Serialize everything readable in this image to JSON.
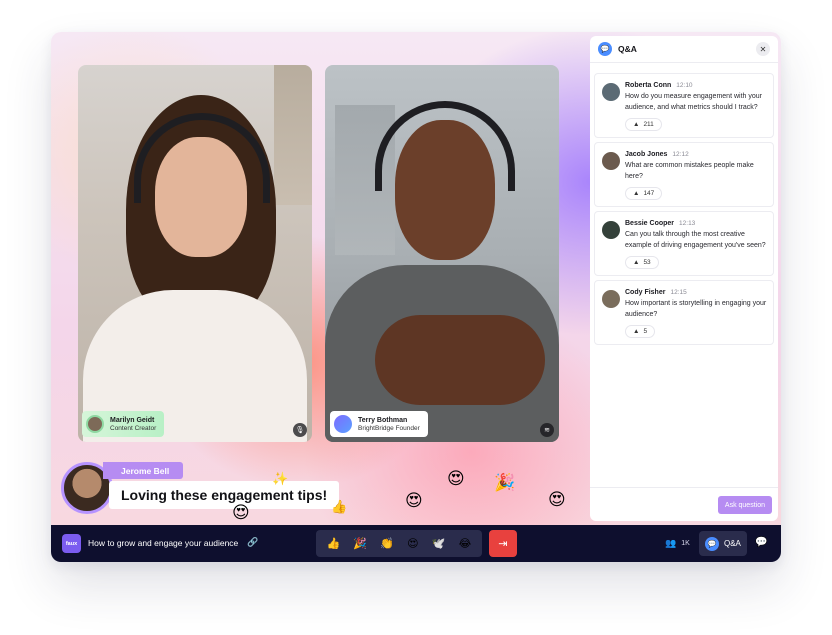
{
  "videos": [
    {
      "name": "Marilyn Geidt",
      "role": "Content Creator",
      "audio_icon": "mic-icon"
    },
    {
      "name": "Terry Bothman",
      "role": "BrightBridge Founder",
      "audio_icon": "audio-wave-icon"
    }
  ],
  "presenter": {
    "name": "Jerome Bell",
    "message": "Loving these engagement tips!"
  },
  "floating_emojis": [
    "😍",
    "🎉",
    "😍",
    "😍",
    "😍",
    "👍",
    "✨"
  ],
  "qa_panel": {
    "title": "Q&A",
    "questions": [
      {
        "name": "Roberta Conn",
        "time": "12:10",
        "text": "How do you measure engagement with your audience, and what metrics should I track?",
        "votes": "211",
        "avatar_color": "#5b6a74"
      },
      {
        "name": "Jacob Jones",
        "time": "12:12",
        "text": "What are common mistakes people make here?",
        "votes": "147",
        "avatar_color": "#6b5a4e"
      },
      {
        "name": "Bessie Cooper",
        "time": "12:13",
        "text": "Can you talk through the most creative example of driving engagement you've seen?",
        "votes": "53",
        "avatar_color": "#34413a"
      },
      {
        "name": "Cody Fisher",
        "time": "12:15",
        "text": "How important is storytelling in engaging your audience?",
        "votes": "5",
        "avatar_color": "#7a6d5c"
      }
    ],
    "ask_button": "Ask question"
  },
  "toolbar": {
    "logo": "faux",
    "topic": "How to grow and engage your audience",
    "reactions": [
      "👍",
      "🎉",
      "👏",
      "😍",
      "🕊️",
      "😂"
    ],
    "participants": "1K",
    "qa_label": "Q&A"
  },
  "colors": {
    "accent": "#b68cf2",
    "toolbar": "#0e0f2e",
    "leave": "#e8413e",
    "qa_blue": "#4a8dff"
  }
}
